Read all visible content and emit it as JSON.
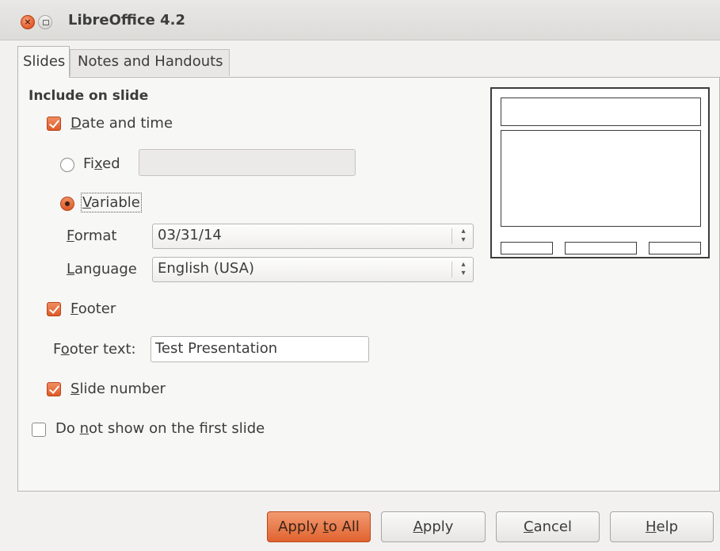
{
  "window": {
    "title": "LibreOffice 4.2",
    "close_glyph": "×"
  },
  "tabs": [
    {
      "label": "Slides",
      "active": true
    },
    {
      "label": "Notes and Handouts",
      "active": false
    }
  ],
  "include": {
    "heading": "Include on slide",
    "date_time": {
      "pre": "",
      "mnemonic": "D",
      "post": "ate and time",
      "checked": true
    },
    "fixed": {
      "pre": "Fi",
      "mnemonic": "x",
      "post": "ed",
      "selected": false,
      "value": ""
    },
    "variable": {
      "pre": "",
      "mnemonic": "V",
      "post": "ariable",
      "selected": true
    },
    "format": {
      "label_pre": "",
      "label_mnemonic": "F",
      "label_post": "ormat",
      "value": "03/31/14"
    },
    "language": {
      "label_pre": "",
      "label_mnemonic": "L",
      "label_post": "anguage",
      "value": "English (USA)"
    },
    "footer": {
      "pre": "",
      "mnemonic": "F",
      "post": "ooter",
      "checked": true
    },
    "footer_text": {
      "label_pre": "F",
      "label_mnemonic": "o",
      "label_post": "oter text:",
      "value": "Test Presentation"
    },
    "slide_number": {
      "pre": "",
      "mnemonic": "S",
      "post": "lide number",
      "checked": true
    },
    "first_slide": {
      "pre": "Do ",
      "mnemonic": "n",
      "post": "ot show on the first slide",
      "checked": false
    }
  },
  "spin_glyph_up": "▴",
  "spin_glyph_down": "▾",
  "buttons": {
    "apply_all": {
      "pre": "Apply ",
      "mnemonic": "t",
      "post": "o All"
    },
    "apply": {
      "pre": "",
      "mnemonic": "A",
      "post": "pply"
    },
    "cancel": {
      "pre": "",
      "mnemonic": "C",
      "post": "ancel"
    },
    "help": {
      "pre": "",
      "mnemonic": "H",
      "post": "elp"
    }
  },
  "colors": {
    "accent": "#e0632f",
    "background": "#f2f1f0"
  }
}
